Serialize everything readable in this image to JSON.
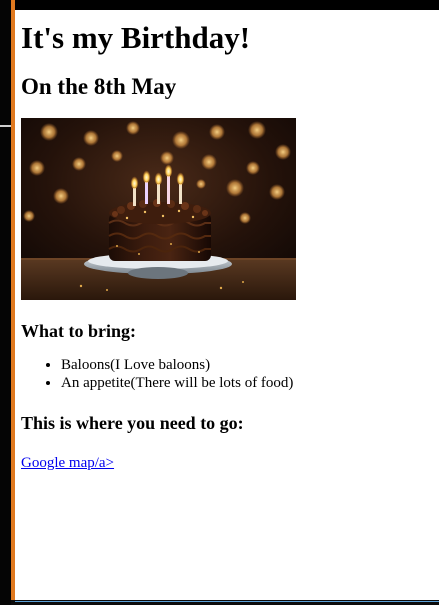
{
  "page": {
    "title": "It's my Birthday!",
    "subtitle": "On the 8th May",
    "bring_heading": "What to bring:",
    "bring_items": [
      "Baloons(I Love baloons)",
      "An appetite(There will be lots of food)"
    ],
    "location_heading": "This is where you need to go:",
    "map_link_text": "Google map/a>"
  },
  "colors": {
    "accent_orange": "#e0791f",
    "link": "#0000ee",
    "page_background": "#ffffff",
    "frame_background": "#000000"
  },
  "icons": {
    "hero_image": "chocolate-birthday-cake-with-candles-image"
  }
}
